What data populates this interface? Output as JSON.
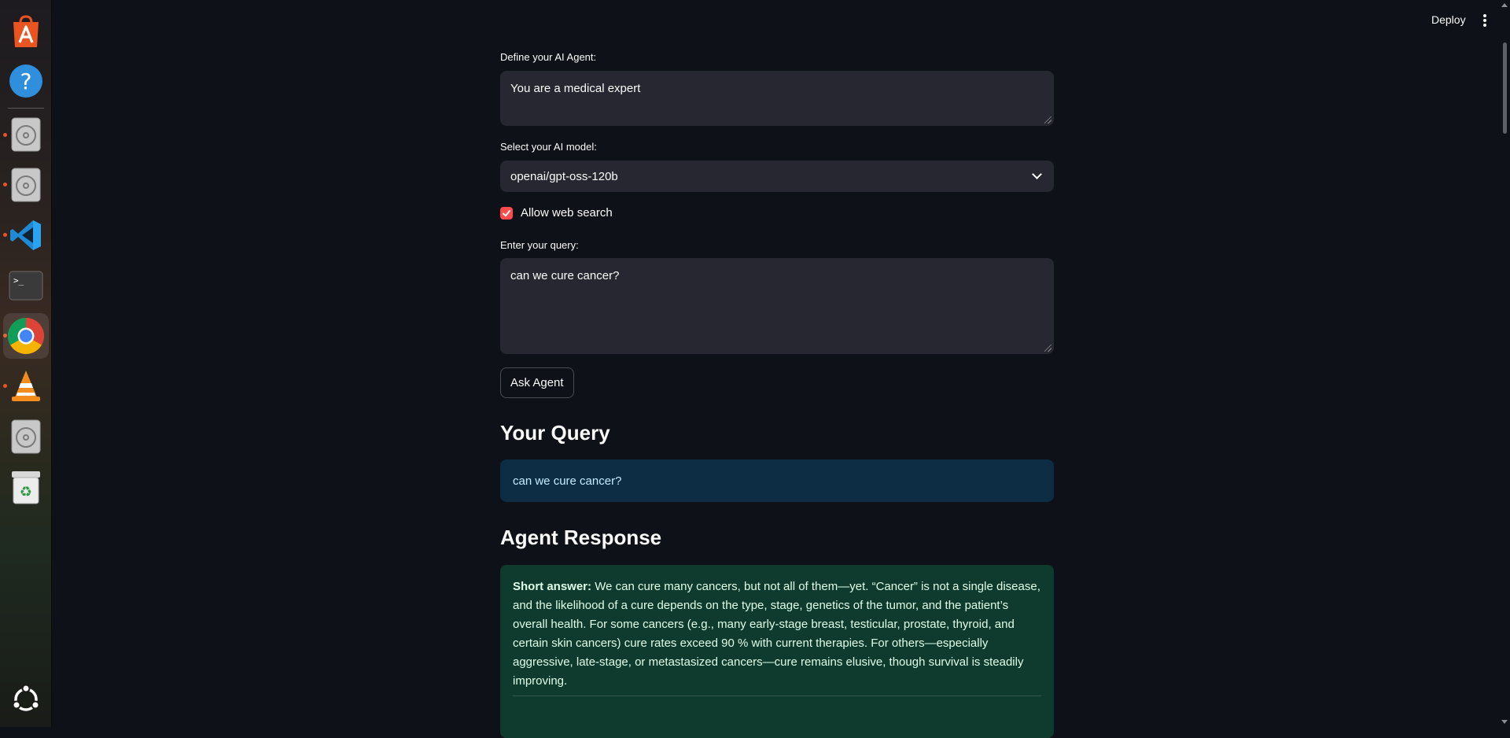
{
  "dock": {
    "items": [
      {
        "name": "app-center-icon"
      },
      {
        "name": "help-icon"
      },
      {
        "name": "disk-icon"
      },
      {
        "name": "disk-icon"
      },
      {
        "name": "vscode-icon"
      },
      {
        "name": "terminal-icon"
      },
      {
        "name": "chrome-icon"
      },
      {
        "name": "vlc-icon"
      },
      {
        "name": "disk-icon"
      },
      {
        "name": "trash-icon"
      },
      {
        "name": "ubuntu-apps-icon"
      }
    ],
    "terminal_glyph": ">_"
  },
  "header": {
    "deploy_label": "Deploy"
  },
  "form": {
    "agent_label": "Define your AI Agent:",
    "agent_value": "You are a medical expert",
    "model_label": "Select your AI model:",
    "model_value": "openai/gpt-oss-120b",
    "web_search_label": "Allow web search",
    "web_search_checked": true,
    "query_label": "Enter your query:",
    "query_value": "can we cure cancer?",
    "ask_button_label": "Ask Agent"
  },
  "results": {
    "query_heading": "Your Query",
    "query_text": "can we cure cancer?",
    "response_heading": "Agent Response",
    "response_lead": "Short answer:",
    "response_body": "We can cure many cancers, but not all of them—yet. “Cancer” is not a single disease, and the likelihood of a cure depends on the type, stage, genetics of the tumor, and the patient’s overall health. For some cancers (e.g., many early-stage breast, testicular, prostate, thyroid, and certain skin cancers) cure rates exceed 90 % with current therapies. For others—especially aggressive, late-stage, or metastasized cancers—cure remains elusive, though survival is steadily improving."
  },
  "colors": {
    "background": "#0e1117",
    "input_bg": "#262730",
    "accent": "#ff4b4b",
    "info_bg": "#0c2d44",
    "success_bg": "#0e3b2e"
  }
}
